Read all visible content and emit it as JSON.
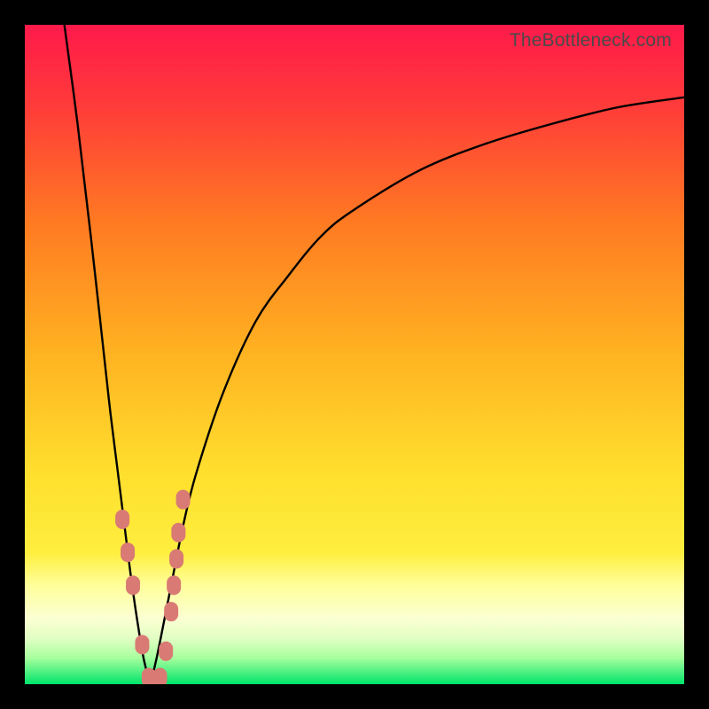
{
  "watermark": "TheBottleneck.com",
  "colors": {
    "frame": "#000000",
    "curve": "#000000",
    "marker_fill": "#d97b74",
    "marker_stroke": "#c96a63",
    "grad_top": "#ff1a4b",
    "grad_q1": "#ff5530",
    "grad_mid": "#ffb321",
    "grad_q3": "#ffe63a",
    "grad_pale": "#ffff9a",
    "grad_near_bottom": "#c8ffa0",
    "grad_bottom": "#00e46a"
  },
  "chart_data": {
    "type": "line",
    "title": "",
    "xlabel": "",
    "ylabel": "",
    "xlim": [
      0,
      100
    ],
    "ylim": [
      0,
      100
    ],
    "series": [
      {
        "name": "left-branch",
        "x": [
          6,
          8,
          10,
          12,
          13,
          14,
          15,
          16,
          17,
          18,
          19
        ],
        "y": [
          100,
          85,
          68,
          50,
          41,
          33,
          25,
          17,
          10,
          4,
          0
        ]
      },
      {
        "name": "right-branch",
        "x": [
          19,
          20,
          22,
          24,
          26,
          30,
          35,
          40,
          45,
          50,
          60,
          70,
          80,
          90,
          100
        ],
        "y": [
          0,
          4,
          14,
          24,
          32,
          44,
          55,
          62,
          68,
          72,
          78,
          82,
          85,
          87.5,
          89
        ]
      }
    ],
    "markers": {
      "name": "data-points",
      "x": [
        14.8,
        15.6,
        16.4,
        17.8,
        18.8,
        19.6,
        20.5,
        21.4,
        22.2,
        22.6,
        23.0,
        23.3,
        24.0
      ],
      "y": [
        25,
        20,
        15,
        6,
        1,
        0.5,
        1,
        5,
        11,
        15,
        19,
        23,
        28
      ]
    }
  }
}
